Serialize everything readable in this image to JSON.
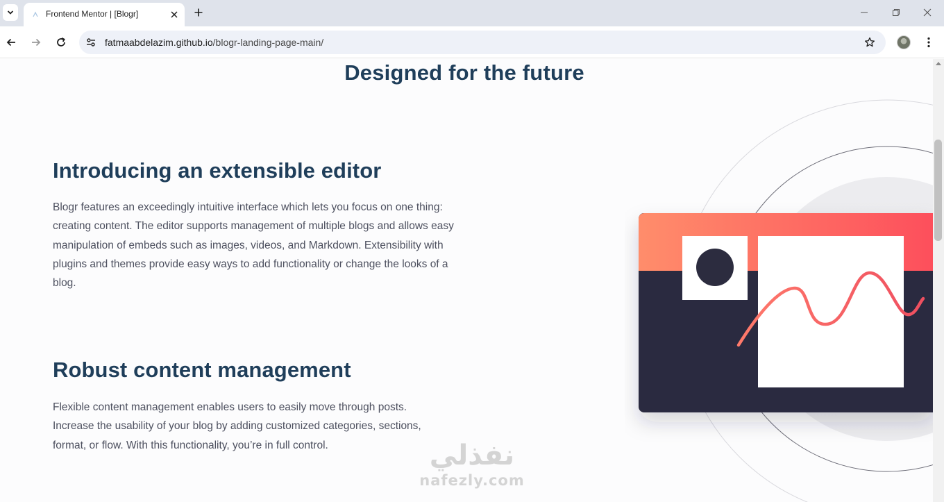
{
  "browser": {
    "tab_title": "Frontend Mentor | [Blogr]",
    "url_host": "fatmaabdelazim.github.io",
    "url_path": "/blogr-landing-page-main/"
  },
  "page": {
    "section_title": "Designed for the future",
    "features": [
      {
        "title": "Introducing an extensible editor",
        "text": "Blogr features an exceedingly intuitive interface which lets you focus on one thing: creating content. The editor supports management of multiple blogs and allows easy manipulation of embeds such as images, videos, and Markdown. Extensibility with plugins and themes provide easy ways to add functionality or change the looks of a blog."
      },
      {
        "title": "Robust content management",
        "text": "Flexible content management enables users to easily move through posts. Increase the usability of your blog by adding customized categories, sections, format, or flow. With this functionality, you’re in full control."
      }
    ]
  },
  "watermark": {
    "arabic": "نفذلي",
    "latin": "nafezly.com"
  },
  "colors": {
    "heading": "#1f3e5a",
    "body_text": "#4d505f",
    "illustration_dark": "#2c2c3f",
    "illustration_gradient_start": "#ff8d6b",
    "illustration_gradient_end": "#fd4f5c",
    "wave": "#f25e66"
  }
}
